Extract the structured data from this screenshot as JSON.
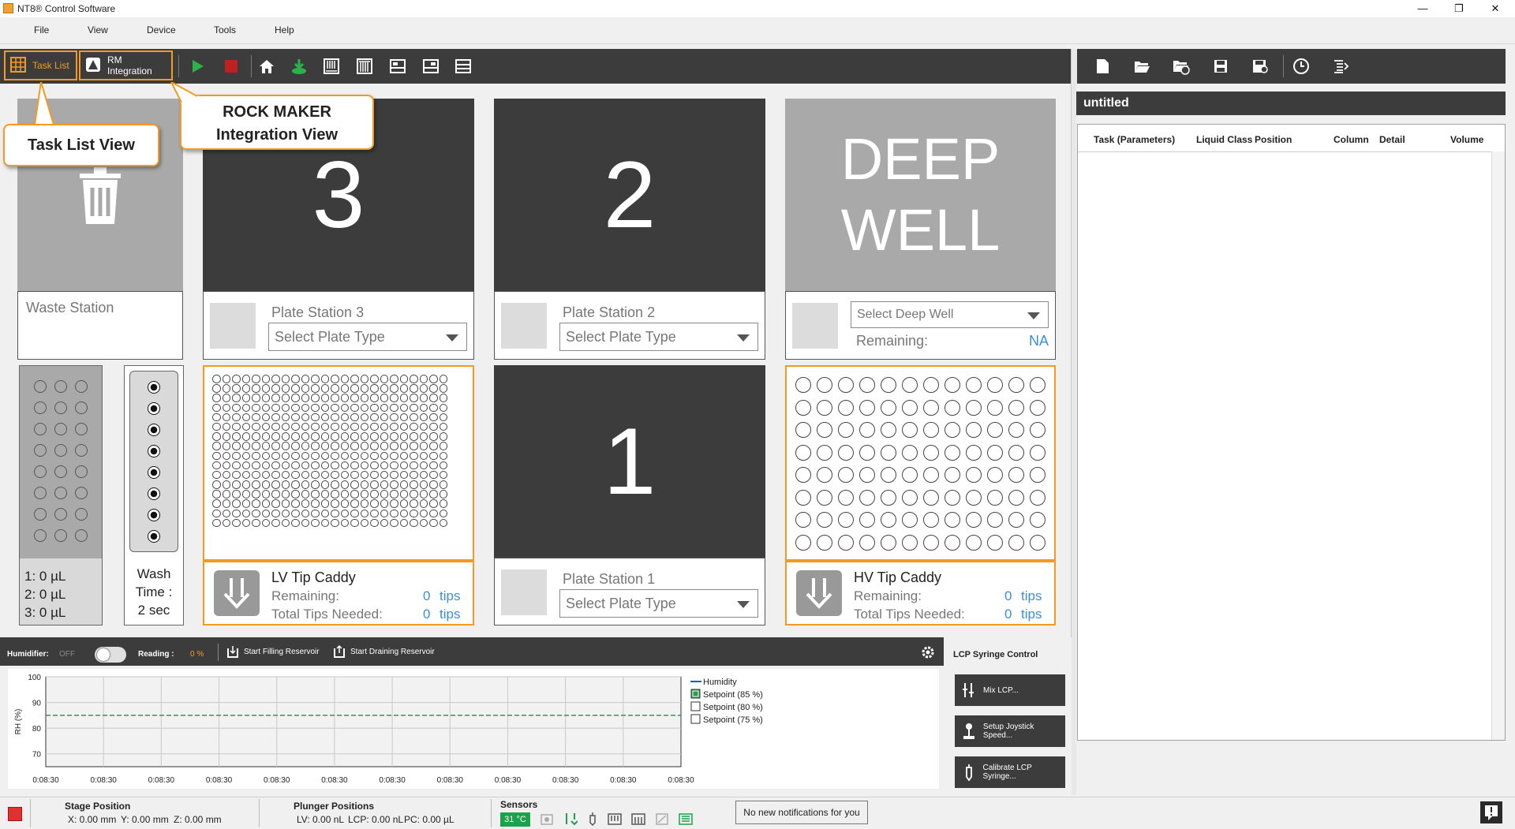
{
  "window": {
    "title": "NT8® Control Software",
    "minimize": "—",
    "maximize": "❐",
    "close": "✕"
  },
  "menu": [
    "File",
    "View",
    "Device",
    "Tools",
    "Help"
  ],
  "toolbar": {
    "task_list_label": "Task List",
    "rm_integration_label": "RM Integration",
    "buttons": [
      "play-icon",
      "stop-icon",
      "home-icon",
      "prime-icon",
      "plate-view-icon",
      "plate-view-2-icon",
      "layout-icon",
      "layout-2-icon",
      "layout-3-icon"
    ]
  },
  "callouts": {
    "task_list_view": "Task List View",
    "rock_maker_line1": "ROCK MAKER",
    "rock_maker_line2": "Integration View"
  },
  "deck": {
    "waste_station_label": "Waste Station",
    "plate_station_3": {
      "number": "3",
      "label": "Plate Station 3",
      "select": "Select Plate Type"
    },
    "plate_station_2": {
      "number": "2",
      "label": "Plate Station 2",
      "select": "Select Plate Type"
    },
    "plate_station_1": {
      "number": "1",
      "label": "Plate Station 1",
      "select": "Select Plate Type"
    },
    "deep_well": {
      "line1": "DEEP",
      "line2": "WELL",
      "select": "Select Deep Well",
      "remaining_label": "Remaining:",
      "remaining_value": "NA"
    },
    "reservoir": {
      "line1": "1: 0 µL",
      "line2": "2: 0 µL",
      "line3": "3: 0 µL"
    },
    "wash": {
      "line1": "Wash",
      "line2": "Time :",
      "line3": "2 sec"
    },
    "lv_tip_caddy": {
      "title": "LV Tip Caddy",
      "remaining_label": "Remaining:",
      "remaining_value": "0",
      "remaining_unit": "tips",
      "needed_label": "Total Tips Needed:",
      "needed_value": "0",
      "needed_unit": "tips"
    },
    "hv_tip_caddy": {
      "title": "HV Tip Caddy",
      "remaining_label": "Remaining:",
      "remaining_value": "0",
      "remaining_unit": "tips",
      "needed_label": "Total Tips Needed:",
      "needed_value": "0",
      "needed_unit": "tips"
    }
  },
  "humidifier": {
    "label": "Humidifier:",
    "state": "OFF",
    "reading_label": "Reading :",
    "reading_value": "0 %",
    "start_filling": "Start Filling Reservoir",
    "start_draining": "Start Draining Reservoir"
  },
  "chart_data": {
    "type": "line",
    "ylabel": "RH (%)",
    "ylim": [
      65,
      100
    ],
    "yticks": [
      "100",
      "90",
      "80",
      "70"
    ],
    "x": [
      "0:08:30",
      "0:08:30",
      "0:08:30",
      "0:08:30",
      "0:08:30",
      "0:08:30",
      "0:08:30",
      "0:08:30",
      "0:08:30",
      "0:08:30",
      "0:08:30",
      "0:08:30"
    ],
    "grid": true,
    "legend_placement": "right",
    "series": [
      {
        "name": "Humidity",
        "values": [],
        "color": "#1f5fae"
      },
      {
        "name": "Setpoint (85 %)",
        "values": [
          85,
          85,
          85,
          85,
          85,
          85,
          85,
          85,
          85,
          85,
          85,
          85
        ],
        "color": "#2e9a4e",
        "checked": true
      },
      {
        "name": "Setpoint (80 %)",
        "values": [],
        "checked": false
      },
      {
        "name": "Setpoint (75 %)",
        "values": [],
        "checked": false
      }
    ]
  },
  "lcp": {
    "title": "LCP Syringe Control",
    "buttons": [
      "Mix LCP...",
      "Setup Joystick Speed...",
      "Calibrate LCP Syringe..."
    ]
  },
  "task_panel": {
    "file_title": "untitled",
    "columns": [
      "Task (Parameters)",
      "Liquid Class",
      "Position",
      "Column",
      "Detail",
      "Volume"
    ],
    "toolbar_icons": [
      "new-file-icon",
      "open-folder-icon",
      "open-recent-icon",
      "save-icon",
      "save-as-icon",
      "clock-icon",
      "list-icon"
    ]
  },
  "status": {
    "stage_title": "Stage Position",
    "stage_x": "X: 0.00 mm",
    "stage_y": "Y: 0.00 mm",
    "stage_z": "Z: 0.00 mm",
    "plunger_title": "Plunger Positions",
    "plunger_lv": "LV: 0.00 nL",
    "plunger_lcp": "LCP: 0.00 nL",
    "plunger_pc": "PC: 0.00 µL",
    "sensors_title": "Sensors",
    "temperature": "31 °C",
    "notifications": "No new notifications for you",
    "accent": "#f39a25",
    "sensor_green": "#1aa34a",
    "error_red": "#e03030"
  }
}
